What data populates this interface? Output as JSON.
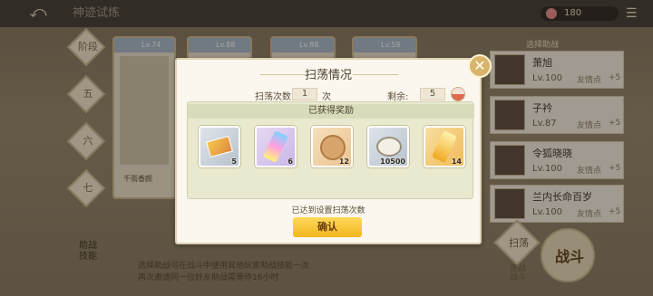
{
  "colors": {
    "accent": "#f2b61e",
    "panel": "#fbf7ee",
    "reward_panel": "#e8e9cf"
  },
  "topbar": {
    "back_icon": "back-arrow-icon",
    "title": "神迹试炼",
    "currency_value": "180"
  },
  "sidebar": {
    "items": [
      {
        "label": "阶段"
      },
      {
        "label": "五"
      },
      {
        "label": "六"
      },
      {
        "label": "七"
      }
    ],
    "footer_label": "助战\n技能"
  },
  "cards": [
    {
      "level": "Lv.74",
      "name": "千雨香颜"
    },
    {
      "level": "Lv.88"
    },
    {
      "level": "Lv.88"
    },
    {
      "level": "Lv.59"
    }
  ],
  "hero_list": {
    "header": "选择助战",
    "rows": [
      {
        "name": "萧旭",
        "level": "Lv.100",
        "affinity": "友情点",
        "plus": "+5"
      },
      {
        "name": "子衿",
        "level": "Lv.87",
        "affinity": "友情点",
        "plus": "+5"
      },
      {
        "name": "令狐晓晓",
        "level": "Lv.100",
        "affinity": "友情点",
        "plus": "+5"
      },
      {
        "name": "兰内长命百岁",
        "level": "Lv.100",
        "affinity": "友情点",
        "plus": "+5"
      }
    ]
  },
  "bottom_right": {
    "sweep_label": "扫荡",
    "battle_label": "战斗",
    "auto_label": "连战\n战斗"
  },
  "footnote": {
    "line1": "选择助战可在战斗中使用其他玩家助战技能一次",
    "line2": "再次邀请同一位好友助战需等待16小时"
  },
  "dialog": {
    "title": "扫荡情况",
    "sweep_count_label": "扫荡次数",
    "sweep_count": "1",
    "sweep_unit": "次",
    "remaining_label": "剩余:",
    "remaining": "5",
    "rewards_header": "已获得奖励",
    "rewards": [
      {
        "icon": "golden-card-icon",
        "count": "5"
      },
      {
        "icon": "rainbow-crystal-icon",
        "count": "6"
      },
      {
        "icon": "cookie-icon",
        "count": "12"
      },
      {
        "icon": "silver-shell-icon",
        "count": "10500"
      },
      {
        "icon": "gold-crystal-icon",
        "count": "14"
      }
    ],
    "status": "已达到设置扫荡次数",
    "confirm_label": "确认"
  }
}
